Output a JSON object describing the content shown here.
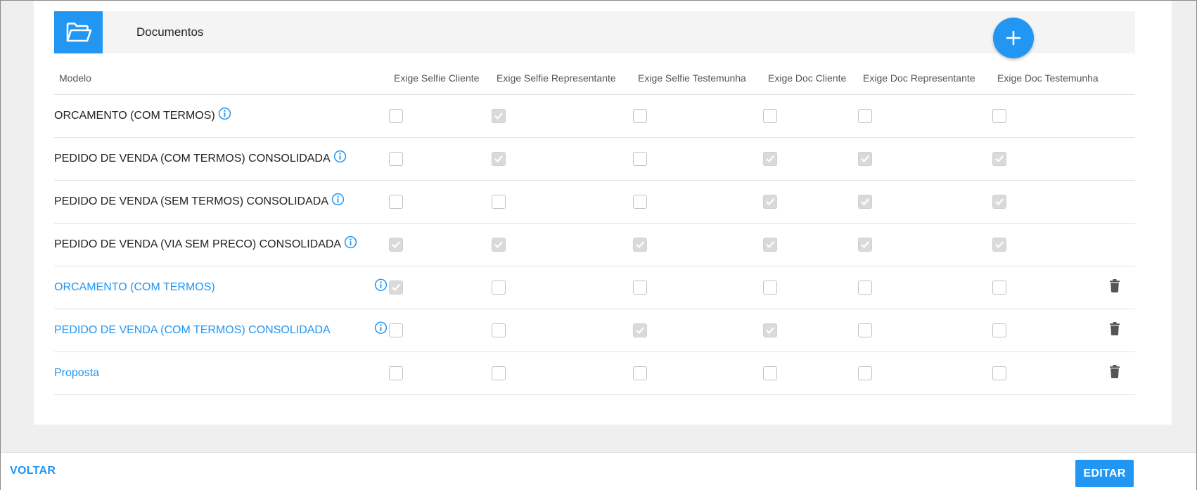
{
  "section": {
    "title": "Documentos",
    "add_icon": "plus-icon",
    "folder_icon": "folder-open-icon"
  },
  "table": {
    "headers": [
      "Modelo",
      "Exige Selfie Cliente",
      "Exige Selfie Representante",
      "Exige Selfie Testemunha",
      "Exige Doc Cliente",
      "Exige Doc Representante",
      "Exige Doc Testemunha"
    ],
    "rows": [
      {
        "label": "ORCAMENTO (COM TERMOS)",
        "link": false,
        "info": "inline",
        "deletable": false,
        "checks": [
          false,
          true,
          false,
          false,
          false,
          false
        ]
      },
      {
        "label": "PEDIDO DE VENDA (COM TERMOS) CONSOLIDADA",
        "link": false,
        "info": "inline",
        "deletable": false,
        "checks": [
          false,
          true,
          false,
          true,
          true,
          true
        ]
      },
      {
        "label": "PEDIDO DE VENDA (SEM TERMOS) CONSOLIDADA",
        "link": false,
        "info": "inline",
        "deletable": false,
        "checks": [
          false,
          false,
          false,
          true,
          true,
          true
        ]
      },
      {
        "label": "PEDIDO DE VENDA (VIA SEM PRECO) CONSOLIDADA",
        "link": false,
        "info": "inline",
        "deletable": false,
        "checks": [
          true,
          true,
          true,
          true,
          true,
          true
        ]
      },
      {
        "label": "ORCAMENTO (COM TERMOS)",
        "link": true,
        "info": "right",
        "deletable": true,
        "checks": [
          true,
          false,
          false,
          false,
          false,
          false
        ]
      },
      {
        "label": "PEDIDO DE VENDA (COM TERMOS) CONSOLIDADA",
        "link": true,
        "info": "right",
        "deletable": true,
        "checks": [
          false,
          false,
          true,
          true,
          false,
          false
        ]
      },
      {
        "label": "Proposta",
        "link": true,
        "info": "none",
        "deletable": true,
        "checks": [
          false,
          false,
          false,
          false,
          false,
          false
        ]
      }
    ]
  },
  "footer": {
    "back_label": "VOLTAR",
    "edit_label": "EDITAR"
  },
  "colors": {
    "accent": "#2196f3",
    "checkbox_checked": "#dadada",
    "trash": "#555555"
  }
}
